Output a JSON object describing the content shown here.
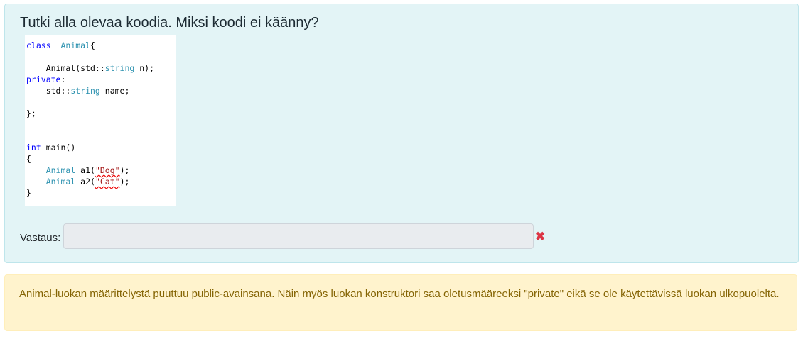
{
  "question": {
    "title": "Tutki alla olevaa koodia. Miksi koodi ei käänny?",
    "code_lines": [
      [
        [
          "kw",
          "class"
        ],
        [
          "",
          "  "
        ],
        [
          "ty",
          "Animal"
        ],
        [
          "",
          "{"
        ]
      ],
      [],
      [
        [
          "",
          "    Animal(std::"
        ],
        [
          "ty",
          "string"
        ],
        [
          "",
          " n);"
        ]
      ],
      [
        [
          "kw",
          "private"
        ],
        [
          "",
          ":"
        ]
      ],
      [
        [
          "",
          "    std::"
        ],
        [
          "ty",
          "string"
        ],
        [
          "",
          " name;"
        ]
      ],
      [],
      [
        [
          "",
          "};"
        ]
      ],
      [],
      [],
      [
        [
          "kw",
          "int"
        ],
        [
          "",
          " main()"
        ]
      ],
      [
        [
          "",
          "{"
        ]
      ],
      [
        [
          "",
          "    "
        ],
        [
          "ty",
          "Animal"
        ],
        [
          "",
          " a1("
        ],
        [
          "st",
          "\"Dog\""
        ],
        [
          "",
          ");"
        ]
      ],
      [
        [
          "",
          "    "
        ],
        [
          "ty",
          "Animal"
        ],
        [
          "",
          " a2("
        ],
        [
          "st",
          "\"Cat\""
        ],
        [
          "",
          ");"
        ]
      ],
      [
        [
          "",
          "}"
        ]
      ]
    ],
    "answer_label": "Vastaus:",
    "answer_value": "",
    "status_icon": "wrong-x-icon"
  },
  "feedback": {
    "text": "Animal-luokan määrittelystä puuttuu public-avainsana. Näin myös luokan konstruktori saa oletusmääreeksi \"private\" eikä se ole käytettävissä luokan ulkopuolelta."
  },
  "colors": {
    "keyword": "#0000ff",
    "type": "#2b91af",
    "string": "#a31515",
    "error": "#dc3545",
    "alert_text": "#856404"
  }
}
